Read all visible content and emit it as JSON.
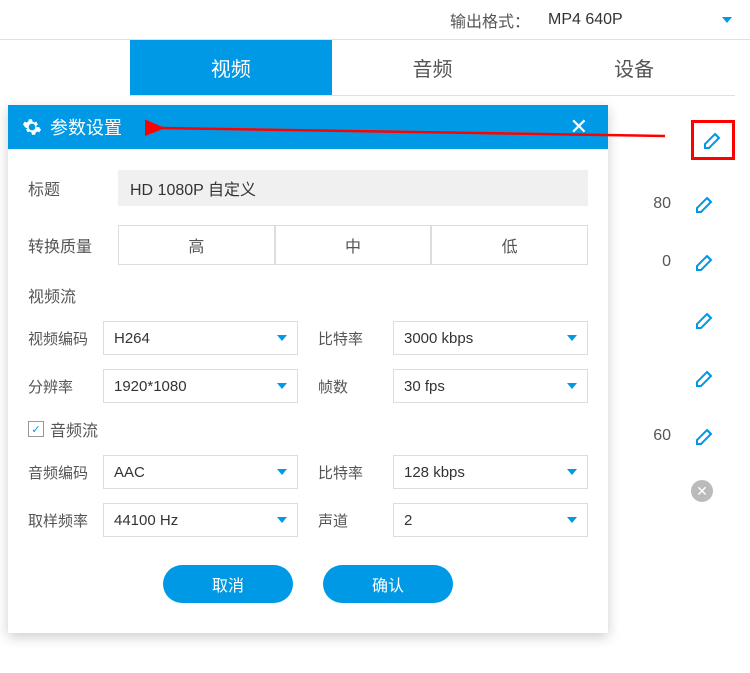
{
  "top": {
    "format_label": "输出格式：",
    "format_value": "MP4  640P"
  },
  "tabs": {
    "video": "视频",
    "audio": "音频",
    "device": "设备"
  },
  "list_rows": [
    {
      "text": "",
      "type": "edit",
      "highlighted": true
    },
    {
      "text": "80",
      "type": "edit"
    },
    {
      "text": "0",
      "type": "edit"
    },
    {
      "text": "",
      "type": "edit"
    },
    {
      "text": "",
      "type": "edit"
    },
    {
      "text": "60",
      "type": "edit"
    },
    {
      "text": "",
      "type": "close"
    }
  ],
  "dialog": {
    "title": "参数设置",
    "title_label": "标题",
    "title_value": "HD 1080P 自定义",
    "quality_label": "转换质量",
    "quality_high": "高",
    "quality_med": "中",
    "quality_low": "低",
    "video_stream": "视频流",
    "video_codec_label": "视频编码",
    "video_codec_value": "H264",
    "bitrate_label": "比特率",
    "video_bitrate_value": "3000 kbps",
    "resolution_label": "分辨率",
    "resolution_value": "1920*1080",
    "fps_label": "帧数",
    "fps_value": "30 fps",
    "audio_stream": "音频流",
    "audio_codec_label": "音频编码",
    "audio_codec_value": "AAC",
    "audio_bitrate_value": "128 kbps",
    "sample_rate_label": "取样频率",
    "sample_rate_value": "44100 Hz",
    "channel_label": "声道",
    "channel_value": "2",
    "cancel": "取消",
    "confirm": "确认"
  }
}
